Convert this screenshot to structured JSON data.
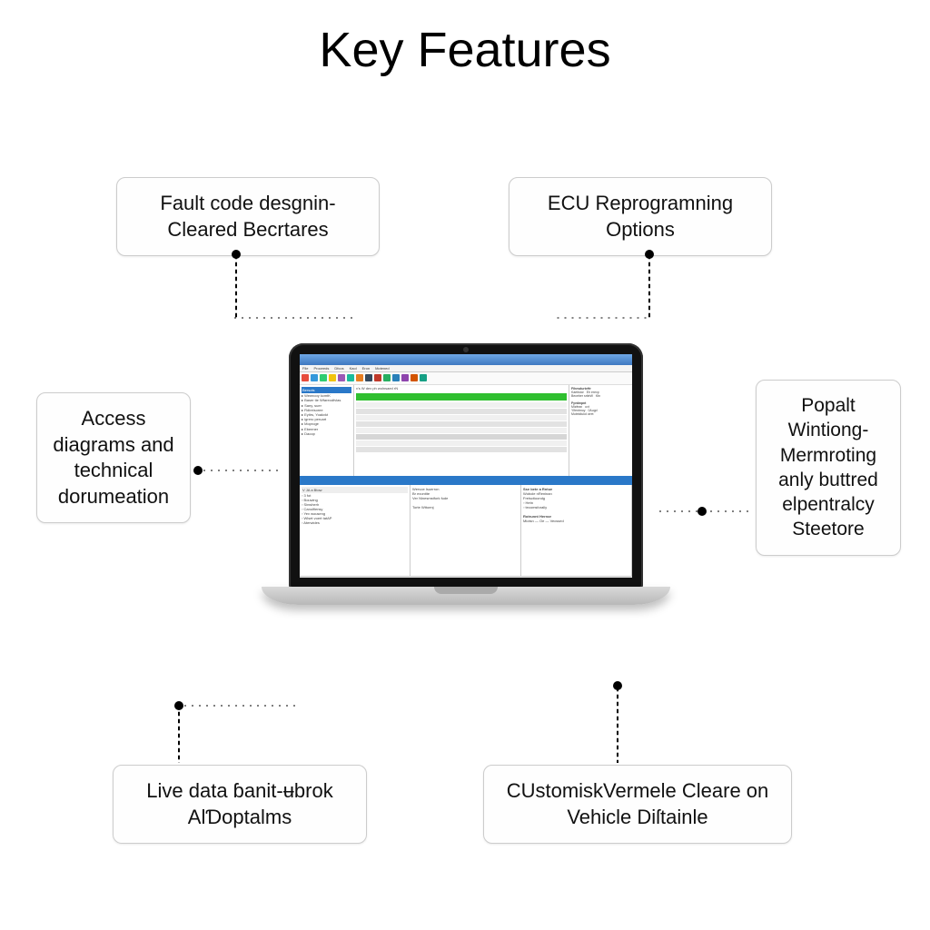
{
  "title": "Key Features",
  "features": {
    "top_left": "Fault code desgnin-Cleared Becrtares",
    "top_right": "ECU Reprogramning Options",
    "left": "Access diagrams and technical dorumeation",
    "right": "Popalt Wintiong-Mermroting anly buttred elpentralcy Steetore",
    "bottom_left": "Live data ɓanit-ʉbrok AlƊoptalms",
    "bottom_right": "CUstomiskVermele Cleare on Vehicle Diſtainle"
  },
  "laptop": {
    "menu": [
      "File",
      "Proceeds",
      "Dfcos",
      "Kaol",
      "Eron",
      "Motened"
    ],
    "tree_header": "Bersots",
    "toolbar_colors": [
      "#e74c3c",
      "#3498db",
      "#2ecc71",
      "#f1c40f",
      "#9b59b6",
      "#1abc9c",
      "#e67e22",
      "#34495e",
      "#c0392b",
      "#27ae60",
      "#2980b9",
      "#8e44ad",
      "#d35400",
      "#16a085"
    ]
  }
}
